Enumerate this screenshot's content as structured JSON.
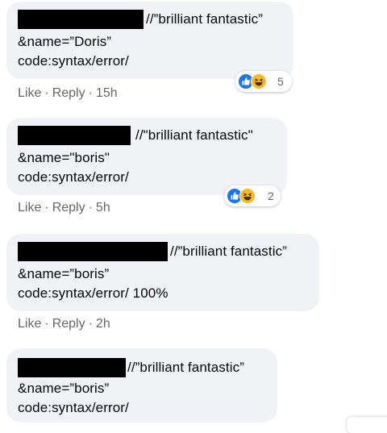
{
  "comments": [
    {
      "lines": [
        "//”brilliant fantastic”",
        "&name=”Doris”",
        "code:syntax/error/"
      ],
      "actions": {
        "like": "Like",
        "reply": "Reply",
        "time": "15h"
      },
      "reaction_count": "5"
    },
    {
      "lines": [
        "//\"brilliant fantastic\"",
        "&name=\"boris\"",
        "code:syntax/error/"
      ],
      "actions": {
        "like": "Like",
        "reply": "Reply",
        "time": "5h"
      },
      "reaction_count": "2"
    },
    {
      "lines": [
        "//”brilliant fantastic”",
        "&name=”boris”",
        "code:syntax/error/ 100%"
      ],
      "actions": {
        "like": "Like",
        "reply": "Reply",
        "time": "2h"
      }
    },
    {
      "lines": [
        "//”brilliant fantastic”",
        "&name=”boris”",
        "code:syntax/error/"
      ]
    }
  ],
  "separator": "·",
  "icons": [
    "like-reaction-icon",
    "haha-reaction-icon"
  ],
  "colors": {
    "bubble": "#f0f2f5",
    "meta_text": "#65676b",
    "like_blue": "#1877f2",
    "haha_yellow": "#f7b928"
  }
}
